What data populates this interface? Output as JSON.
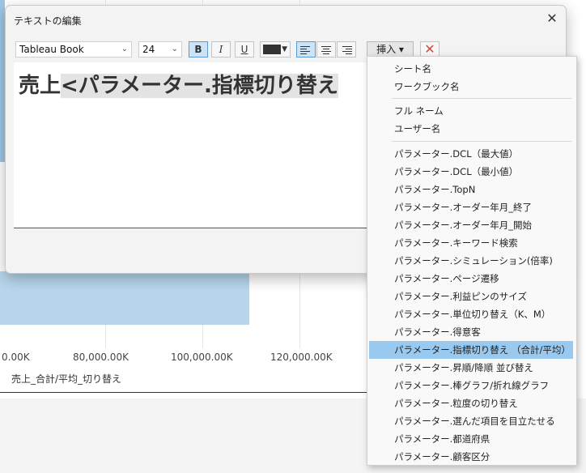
{
  "background": {
    "axis_ticks": [
      "0.00K",
      "80,000.00K",
      "100,000.00K",
      "120,000.00K"
    ],
    "axis_title": "売上_合計/平均_切り替え"
  },
  "dialog": {
    "title": "テキストの編集",
    "close_symbol": "✕",
    "toolbar": {
      "font": "Tableau Book",
      "size": "24",
      "bold_label": "B",
      "italic_label": "I",
      "underline_label": "U",
      "insert_label": "挿入 ▾",
      "clear_symbol": "✕"
    },
    "editor": {
      "plain_text": "売上",
      "selected_text": "<パラメーター.指標切り替え"
    }
  },
  "insert_menu": {
    "group1": [
      "シート名",
      "ワークブック名"
    ],
    "group2": [
      "フル ネーム",
      "ユーザー名"
    ],
    "group3": [
      "パラメーター.DCL（最大値）",
      "パラメーター.DCL（最小値）",
      "パラメーター.TopN",
      "パラメーター.オーダー年月_終了",
      "パラメーター.オーダー年月_開始",
      "パラメーター.キーワード検索",
      "パラメーター.シミュレーション(倍率)",
      "パラメーター.ページ遷移",
      "パラメーター.利益ピンのサイズ",
      "パラメーター.単位切り替え（K、M）",
      "パラメーター.得意客",
      "パラメーター.指標切り替え （合計/平均）",
      "パラメーター.昇順/降順 並び替え",
      "パラメーター.棒グラフ/折れ線グラフ",
      "パラメーター.粒度の切り替え",
      "パラメーター.選んだ項目を目立たせる",
      "パラメーター.都道府県",
      "パラメーター.顧客区分"
    ],
    "highlighted": "パラメーター.指標切り替え （合計/平均）"
  },
  "colors": {
    "highlight": "#99c9ef",
    "bar": "#b7d6ec",
    "accent": "#5b9bd5"
  }
}
